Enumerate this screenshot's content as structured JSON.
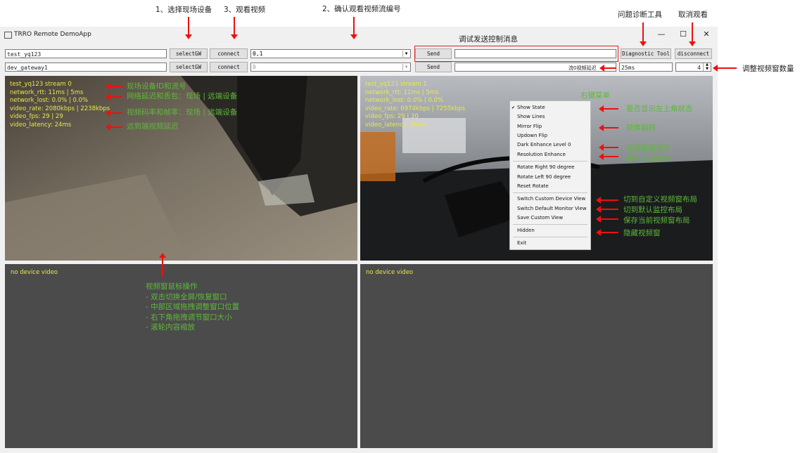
{
  "window": {
    "title": "TRRO Remote DemoApp",
    "min": "—",
    "max": "☐",
    "close": "✕"
  },
  "row1": {
    "device_id": "test_yq123",
    "select_gw": "selectGW",
    "connect": "connect",
    "stream": "0,1",
    "send": "Send",
    "message": "",
    "diag": "Diagnostic Tool",
    "disconnect": "disconnect"
  },
  "row2": {
    "gateway_id": "dev_gateway1",
    "select_gw": "selectGW",
    "connect": "connect",
    "stream": "0",
    "send": "Send",
    "message": "",
    "latency_note": "流0视频延迟",
    "latency": "25ms",
    "count": "4"
  },
  "video0": {
    "lines": [
      "test_yq123 stream 0",
      "network_rtt: 11ms | 5ms",
      "network_lost: 0.0% | 0.0%",
      "video_rate: 2080kbps | 2238kbps",
      "video_fps: 29 | 29",
      "video_latency: 24ms"
    ]
  },
  "video1": {
    "lines": [
      "test_yq123 stream 1",
      "network_rtt: 11ms | 5ms",
      "network_lost: 0.0% | 0.0%",
      "video_rate: 6974kbps | 7255kbps",
      "video_fps: 29 | 30",
      "video_latency: 48ms"
    ]
  },
  "video2": {
    "text": "no device video"
  },
  "video3": {
    "text": "no device video"
  },
  "context_menu": {
    "check": "✔",
    "items": [
      "Show State",
      "Show Lines",
      "Mirror Flip",
      "Updown Flip",
      "Dark Enhance Level 0",
      "Resolution Enhance",
      "Rotate Right 90 degree",
      "Rotate Left 90 degree",
      "Reset Rotate",
      "Switch Custom Device View",
      "Switch Default Monitor View",
      "Save Custom View",
      "Hidden",
      "Exit"
    ]
  },
  "annotations": {
    "top": [
      "1、选择现场设备",
      "3、观看视频",
      "2、确认观看视频流编号",
      "问题诊断工具",
      "取消观看",
      "调试发送控制消息",
      "调整视频窗数量"
    ],
    "video0": [
      "现场设备ID和流号",
      "网络延迟和丢包：现场 | 远端设备",
      "视频码率和帧率：现场 | 远端设备",
      "远到端视频延迟"
    ],
    "menu": [
      "右键菜单",
      "是否显示左上角状态",
      "镜像翻转",
      "夜视增强调节",
      "是否开启超分",
      "切到自定义视频窗布局",
      "切到默认监控布局",
      "保存当前视频窗布局",
      "隐藏视频窗"
    ],
    "mouse": [
      "视频窗鼠标操作",
      "- 双击切换全屏/恢复窗口",
      "- 中部区域拖拽调整窗口位置",
      "- 右下角拖拽调节窗口大小",
      "- 滚轮内容缩放"
    ]
  }
}
